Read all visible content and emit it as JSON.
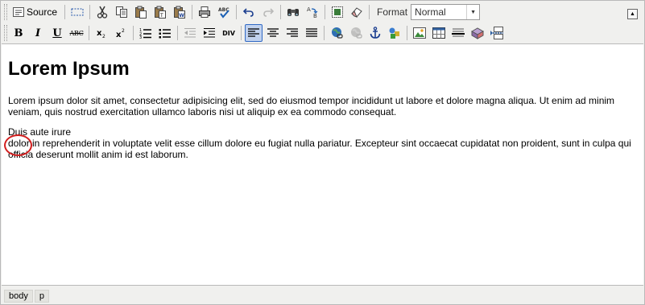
{
  "toolbar": {
    "source_label": "Source",
    "format_label": "Format",
    "format_value": "Normal",
    "bold_label": "B",
    "italic_label": "I",
    "underline_label": "U",
    "strike_label": "ABC",
    "outdent_hint": "",
    "div_label": "DIV"
  },
  "document": {
    "heading": "Lorem Ipsum",
    "paragraph1": "Lorem ipsum dolor sit amet, consectetur adipisicing elit, sed do eiusmod tempor incididunt ut labore et dolore magna aliqua. Ut enim ad minim veniam, quis nostrud exercitation ullamco laboris nisi ut aliquip ex ea commodo consequat.",
    "paragraph2_line1": "Duis aute irure",
    "paragraph2_line2": "dolor in reprehenderit in voluptate velit esse cillum dolore eu fugiat nulla pariatur. Excepteur sint occaecat cupidatat non proident, sunt in culpa qui officia deserunt mollit anim id est laborum."
  },
  "statusbar": {
    "path": [
      "body",
      "p"
    ]
  },
  "colors": {
    "annotation_circle": "#d21e1e",
    "active_button_bg": "#c1d2ee",
    "active_button_border": "#316ac5"
  }
}
